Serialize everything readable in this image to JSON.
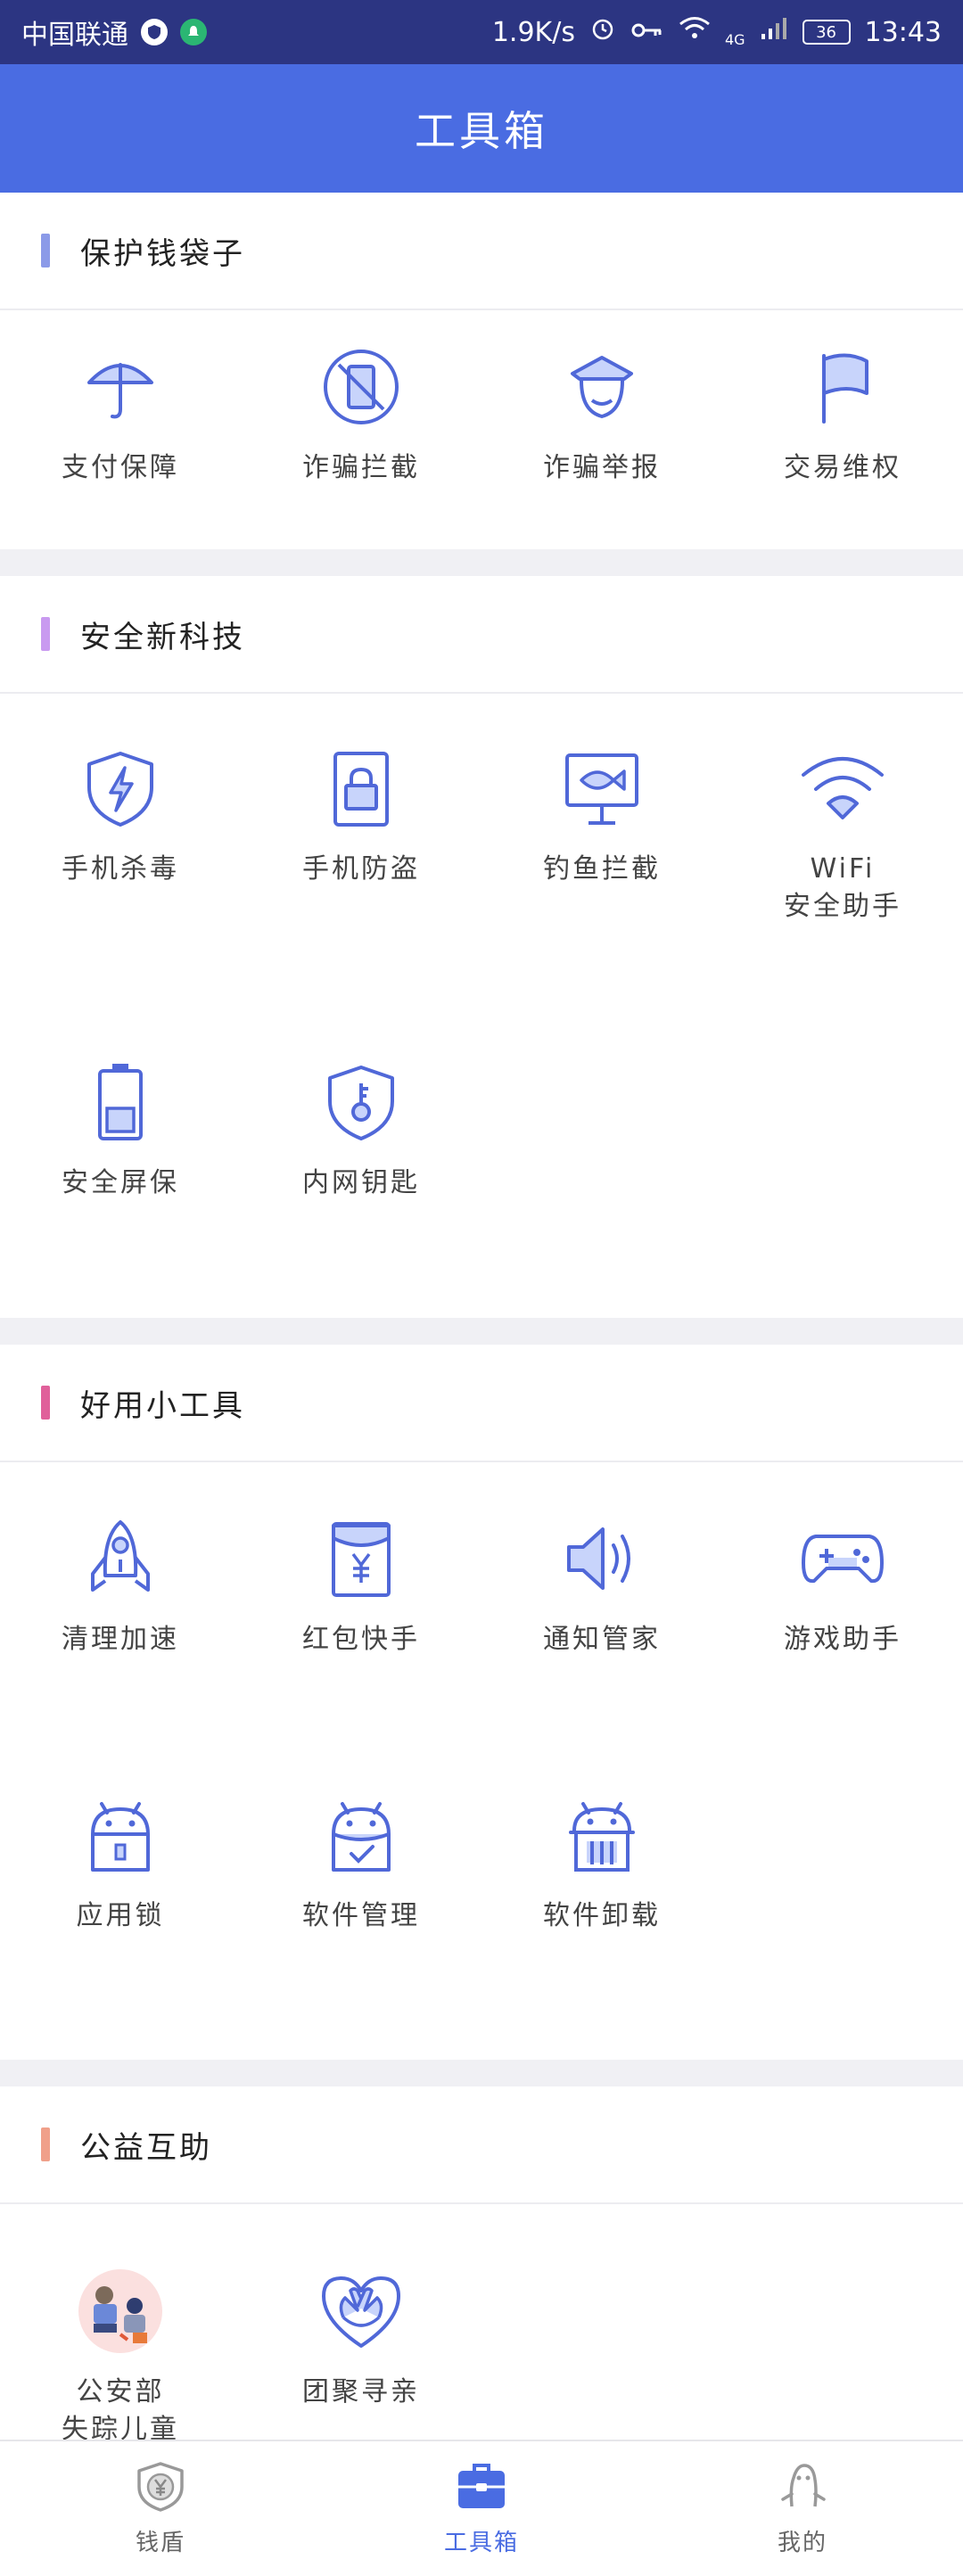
{
  "status_bar": {
    "carrier": "中国联通",
    "speed": "1.9K/s",
    "network": "4G",
    "battery": "36",
    "time": "13:43"
  },
  "header": {
    "title": "工具箱"
  },
  "sections": [
    {
      "title": "保护钱袋子",
      "bar_color": "#8b9ae8",
      "items": [
        {
          "label": "支付保障",
          "icon": "umbrella-icon"
        },
        {
          "label": "诈骗拦截",
          "icon": "phone-block-icon"
        },
        {
          "label": "诈骗举报",
          "icon": "police-icon"
        },
        {
          "label": "交易维权",
          "icon": "flag-icon"
        }
      ]
    },
    {
      "title": "安全新科技",
      "bar_color": "#c99af0",
      "items": [
        {
          "label": "手机杀毒",
          "icon": "shield-bolt-icon"
        },
        {
          "label": "手机防盗",
          "icon": "phone-lock-icon"
        },
        {
          "label": "钓鱼拦截",
          "icon": "fish-monitor-icon"
        },
        {
          "label": "WiFi",
          "label2": "安全助手",
          "icon": "wifi-icon"
        },
        {
          "label": "安全屏保",
          "icon": "battery-icon"
        },
        {
          "label": "内网钥匙",
          "icon": "shield-key-icon"
        }
      ]
    },
    {
      "title": "好用小工具",
      "bar_color": "#e0609a",
      "items": [
        {
          "label": "清理加速",
          "icon": "rocket-icon"
        },
        {
          "label": "红包快手",
          "icon": "red-packet-icon"
        },
        {
          "label": "通知管家",
          "icon": "speaker-icon"
        },
        {
          "label": "游戏助手",
          "icon": "gamepad-icon"
        },
        {
          "label": "应用锁",
          "icon": "android-lock-icon"
        },
        {
          "label": "软件管理",
          "icon": "android-check-icon"
        },
        {
          "label": "软件卸载",
          "icon": "android-trash-icon"
        }
      ]
    },
    {
      "title": "公益互助",
      "bar_color": "#f0a08a",
      "items": [
        {
          "label": "公安部",
          "label2": "失踪儿童",
          "icon": "missing-children-icon"
        },
        {
          "label": "团聚寻亲",
          "icon": "heart-hands-icon"
        }
      ]
    }
  ],
  "bottom_nav": [
    {
      "label": "钱盾",
      "icon": "yuan-shield-icon",
      "active": false
    },
    {
      "label": "工具箱",
      "icon": "toolbox-icon",
      "active": true
    },
    {
      "label": "我的",
      "icon": "person-icon",
      "active": false
    }
  ],
  "colors": {
    "primary": "#4a6ce2",
    "statusbar": "#2c3582",
    "icon_stroke": "#5068d8",
    "icon_fill": "#c8d4fb"
  }
}
